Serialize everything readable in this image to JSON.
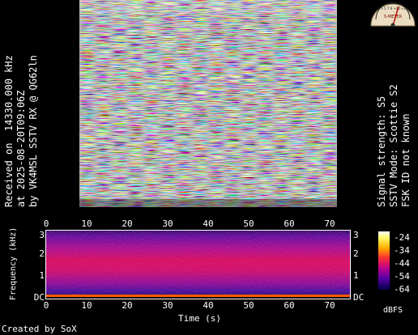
{
  "sstv": {
    "left_line1": "Received on  14330.000 kHz",
    "left_line2": "at 2025-08-20T09:06Z",
    "left_line3": "by VK4MSL SSTV RX @ QG62ln",
    "right_line1": "Signal strength: S5",
    "right_line2": "SSTV Mode: Scottie S2",
    "right_line3": "FSK ID not known"
  },
  "spectrogram": {
    "x_ticks": [
      "0",
      "10",
      "20",
      "30",
      "40",
      "50",
      "60",
      "70"
    ],
    "y_ticks_left": [
      "3",
      "2",
      "1",
      "DC"
    ],
    "y_ticks_right": [
      "3",
      "2",
      "1",
      "DC"
    ],
    "x_label": "Time (s)",
    "y_label": "Frequency (kHz)",
    "colorbar_ticks": [
      "-24",
      "-34",
      "-44",
      "-54",
      "-64"
    ],
    "colorbar_unit": "dBFS"
  },
  "footer": {
    "credit": "Created by SoX"
  },
  "smeter": {
    "label": "S-METER",
    "scale_text": "1 3 5 7 9 +10 +20"
  }
}
